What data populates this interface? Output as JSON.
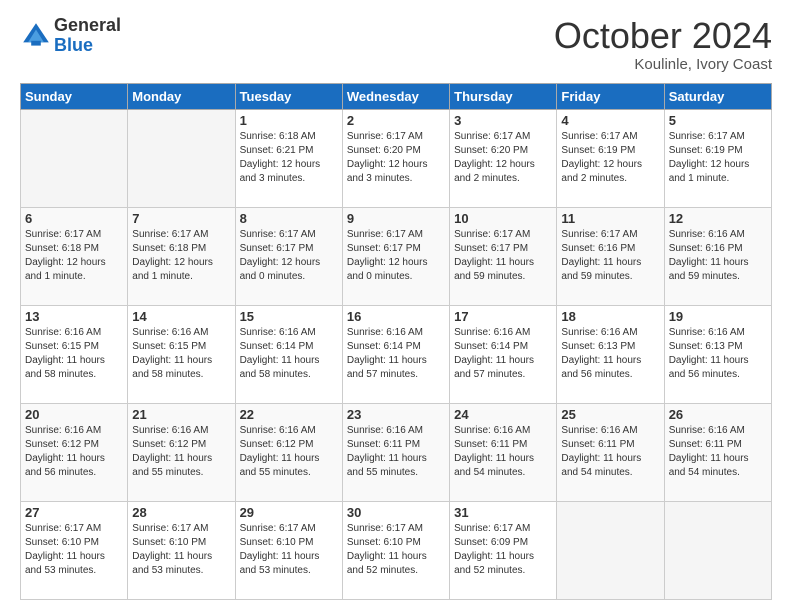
{
  "header": {
    "logo_general": "General",
    "logo_blue": "Blue",
    "month_title": "October 2024",
    "location": "Koulinle, Ivory Coast"
  },
  "days_of_week": [
    "Sunday",
    "Monday",
    "Tuesday",
    "Wednesday",
    "Thursday",
    "Friday",
    "Saturday"
  ],
  "weeks": [
    [
      {
        "day": "",
        "empty": true
      },
      {
        "day": "",
        "empty": true
      },
      {
        "day": "1",
        "sunrise": "Sunrise: 6:18 AM",
        "sunset": "Sunset: 6:21 PM",
        "daylight": "Daylight: 12 hours and 3 minutes."
      },
      {
        "day": "2",
        "sunrise": "Sunrise: 6:17 AM",
        "sunset": "Sunset: 6:20 PM",
        "daylight": "Daylight: 12 hours and 3 minutes."
      },
      {
        "day": "3",
        "sunrise": "Sunrise: 6:17 AM",
        "sunset": "Sunset: 6:20 PM",
        "daylight": "Daylight: 12 hours and 2 minutes."
      },
      {
        "day": "4",
        "sunrise": "Sunrise: 6:17 AM",
        "sunset": "Sunset: 6:19 PM",
        "daylight": "Daylight: 12 hours and 2 minutes."
      },
      {
        "day": "5",
        "sunrise": "Sunrise: 6:17 AM",
        "sunset": "Sunset: 6:19 PM",
        "daylight": "Daylight: 12 hours and 1 minute."
      }
    ],
    [
      {
        "day": "6",
        "sunrise": "Sunrise: 6:17 AM",
        "sunset": "Sunset: 6:18 PM",
        "daylight": "Daylight: 12 hours and 1 minute."
      },
      {
        "day": "7",
        "sunrise": "Sunrise: 6:17 AM",
        "sunset": "Sunset: 6:18 PM",
        "daylight": "Daylight: 12 hours and 1 minute."
      },
      {
        "day": "8",
        "sunrise": "Sunrise: 6:17 AM",
        "sunset": "Sunset: 6:17 PM",
        "daylight": "Daylight: 12 hours and 0 minutes."
      },
      {
        "day": "9",
        "sunrise": "Sunrise: 6:17 AM",
        "sunset": "Sunset: 6:17 PM",
        "daylight": "Daylight: 12 hours and 0 minutes."
      },
      {
        "day": "10",
        "sunrise": "Sunrise: 6:17 AM",
        "sunset": "Sunset: 6:17 PM",
        "daylight": "Daylight: 11 hours and 59 minutes."
      },
      {
        "day": "11",
        "sunrise": "Sunrise: 6:17 AM",
        "sunset": "Sunset: 6:16 PM",
        "daylight": "Daylight: 11 hours and 59 minutes."
      },
      {
        "day": "12",
        "sunrise": "Sunrise: 6:16 AM",
        "sunset": "Sunset: 6:16 PM",
        "daylight": "Daylight: 11 hours and 59 minutes."
      }
    ],
    [
      {
        "day": "13",
        "sunrise": "Sunrise: 6:16 AM",
        "sunset": "Sunset: 6:15 PM",
        "daylight": "Daylight: 11 hours and 58 minutes."
      },
      {
        "day": "14",
        "sunrise": "Sunrise: 6:16 AM",
        "sunset": "Sunset: 6:15 PM",
        "daylight": "Daylight: 11 hours and 58 minutes."
      },
      {
        "day": "15",
        "sunrise": "Sunrise: 6:16 AM",
        "sunset": "Sunset: 6:14 PM",
        "daylight": "Daylight: 11 hours and 58 minutes."
      },
      {
        "day": "16",
        "sunrise": "Sunrise: 6:16 AM",
        "sunset": "Sunset: 6:14 PM",
        "daylight": "Daylight: 11 hours and 57 minutes."
      },
      {
        "day": "17",
        "sunrise": "Sunrise: 6:16 AM",
        "sunset": "Sunset: 6:14 PM",
        "daylight": "Daylight: 11 hours and 57 minutes."
      },
      {
        "day": "18",
        "sunrise": "Sunrise: 6:16 AM",
        "sunset": "Sunset: 6:13 PM",
        "daylight": "Daylight: 11 hours and 56 minutes."
      },
      {
        "day": "19",
        "sunrise": "Sunrise: 6:16 AM",
        "sunset": "Sunset: 6:13 PM",
        "daylight": "Daylight: 11 hours and 56 minutes."
      }
    ],
    [
      {
        "day": "20",
        "sunrise": "Sunrise: 6:16 AM",
        "sunset": "Sunset: 6:12 PM",
        "daylight": "Daylight: 11 hours and 56 minutes."
      },
      {
        "day": "21",
        "sunrise": "Sunrise: 6:16 AM",
        "sunset": "Sunset: 6:12 PM",
        "daylight": "Daylight: 11 hours and 55 minutes."
      },
      {
        "day": "22",
        "sunrise": "Sunrise: 6:16 AM",
        "sunset": "Sunset: 6:12 PM",
        "daylight": "Daylight: 11 hours and 55 minutes."
      },
      {
        "day": "23",
        "sunrise": "Sunrise: 6:16 AM",
        "sunset": "Sunset: 6:11 PM",
        "daylight": "Daylight: 11 hours and 55 minutes."
      },
      {
        "day": "24",
        "sunrise": "Sunrise: 6:16 AM",
        "sunset": "Sunset: 6:11 PM",
        "daylight": "Daylight: 11 hours and 54 minutes."
      },
      {
        "day": "25",
        "sunrise": "Sunrise: 6:16 AM",
        "sunset": "Sunset: 6:11 PM",
        "daylight": "Daylight: 11 hours and 54 minutes."
      },
      {
        "day": "26",
        "sunrise": "Sunrise: 6:16 AM",
        "sunset": "Sunset: 6:11 PM",
        "daylight": "Daylight: 11 hours and 54 minutes."
      }
    ],
    [
      {
        "day": "27",
        "sunrise": "Sunrise: 6:17 AM",
        "sunset": "Sunset: 6:10 PM",
        "daylight": "Daylight: 11 hours and 53 minutes."
      },
      {
        "day": "28",
        "sunrise": "Sunrise: 6:17 AM",
        "sunset": "Sunset: 6:10 PM",
        "daylight": "Daylight: 11 hours and 53 minutes."
      },
      {
        "day": "29",
        "sunrise": "Sunrise: 6:17 AM",
        "sunset": "Sunset: 6:10 PM",
        "daylight": "Daylight: 11 hours and 53 minutes."
      },
      {
        "day": "30",
        "sunrise": "Sunrise: 6:17 AM",
        "sunset": "Sunset: 6:10 PM",
        "daylight": "Daylight: 11 hours and 52 minutes."
      },
      {
        "day": "31",
        "sunrise": "Sunrise: 6:17 AM",
        "sunset": "Sunset: 6:09 PM",
        "daylight": "Daylight: 11 hours and 52 minutes."
      },
      {
        "day": "",
        "empty": true
      },
      {
        "day": "",
        "empty": true
      }
    ]
  ]
}
